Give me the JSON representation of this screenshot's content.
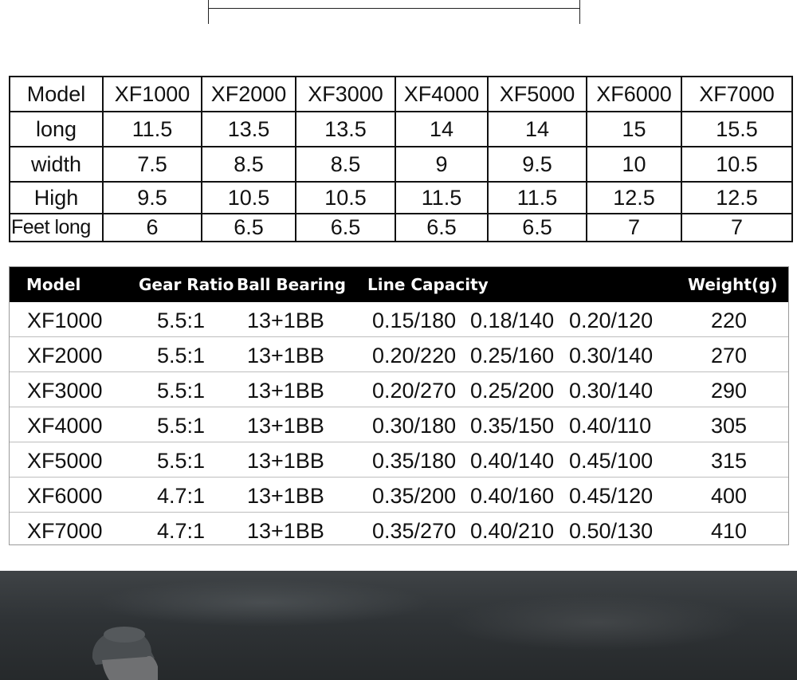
{
  "dimensions_table": {
    "headers": [
      "Model",
      "XF1000",
      "XF2000",
      "XF3000",
      "XF4000",
      "XF5000",
      "XF6000",
      "XF7000"
    ],
    "rows": [
      {
        "label": "long",
        "values": [
          "11.5",
          "13.5",
          "13.5",
          "14",
          "14",
          "15",
          "15.5"
        ]
      },
      {
        "label": "width",
        "values": [
          "7.5",
          "8.5",
          "8.5",
          "9",
          "9.5",
          "10",
          "10.5"
        ]
      },
      {
        "label": "High",
        "values": [
          "9.5",
          "10.5",
          "10.5",
          "11.5",
          "11.5",
          "12.5",
          "12.5"
        ]
      },
      {
        "label": "Feet long",
        "values": [
          "6",
          "6.5",
          "6.5",
          "6.5",
          "6.5",
          "7",
          "7"
        ]
      }
    ]
  },
  "spec_table": {
    "headers": {
      "model": "Model",
      "gear_ratio": "Gear Ratio",
      "ball_bearing": "Ball Bearing",
      "line_capacity": "Line Capacity",
      "weight": "Weight(g)"
    },
    "rows": [
      {
        "model": "XF1000",
        "gear_ratio": "5.5:1",
        "ball_bearing": "13+1BB",
        "cap1": "0.15/180",
        "cap2": "0.18/140",
        "cap3": "0.20/120",
        "weight": "220"
      },
      {
        "model": "XF2000",
        "gear_ratio": "5.5:1",
        "ball_bearing": "13+1BB",
        "cap1": "0.20/220",
        "cap2": "0.25/160",
        "cap3": "0.30/140",
        "weight": "270"
      },
      {
        "model": "XF3000",
        "gear_ratio": "5.5:1",
        "ball_bearing": "13+1BB",
        "cap1": "0.20/270",
        "cap2": "0.25/200",
        "cap3": "0.30/140",
        "weight": "290"
      },
      {
        "model": "XF4000",
        "gear_ratio": "5.5:1",
        "ball_bearing": "13+1BB",
        "cap1": "0.30/180",
        "cap2": "0.35/150",
        "cap3": "0.40/110",
        "weight": "305"
      },
      {
        "model": "XF5000",
        "gear_ratio": "5.5:1",
        "ball_bearing": "13+1BB",
        "cap1": "0.35/180",
        "cap2": "0.40/140",
        "cap3": "0.45/100",
        "weight": "315"
      },
      {
        "model": "XF6000",
        "gear_ratio": "4.7:1",
        "ball_bearing": "13+1BB",
        "cap1": "0.35/200",
        "cap2": "0.40/160",
        "cap3": "0.45/120",
        "weight": "400"
      },
      {
        "model": "XF7000",
        "gear_ratio": "4.7:1",
        "ball_bearing": "13+1BB",
        "cap1": "0.35/270",
        "cap2": "0.40/210",
        "cap3": "0.50/130",
        "weight": "410"
      }
    ]
  },
  "colors": {
    "header_bg": "#000000",
    "header_text": "#ffffff",
    "text": "#111111",
    "photo_tone": "#2f3336"
  }
}
